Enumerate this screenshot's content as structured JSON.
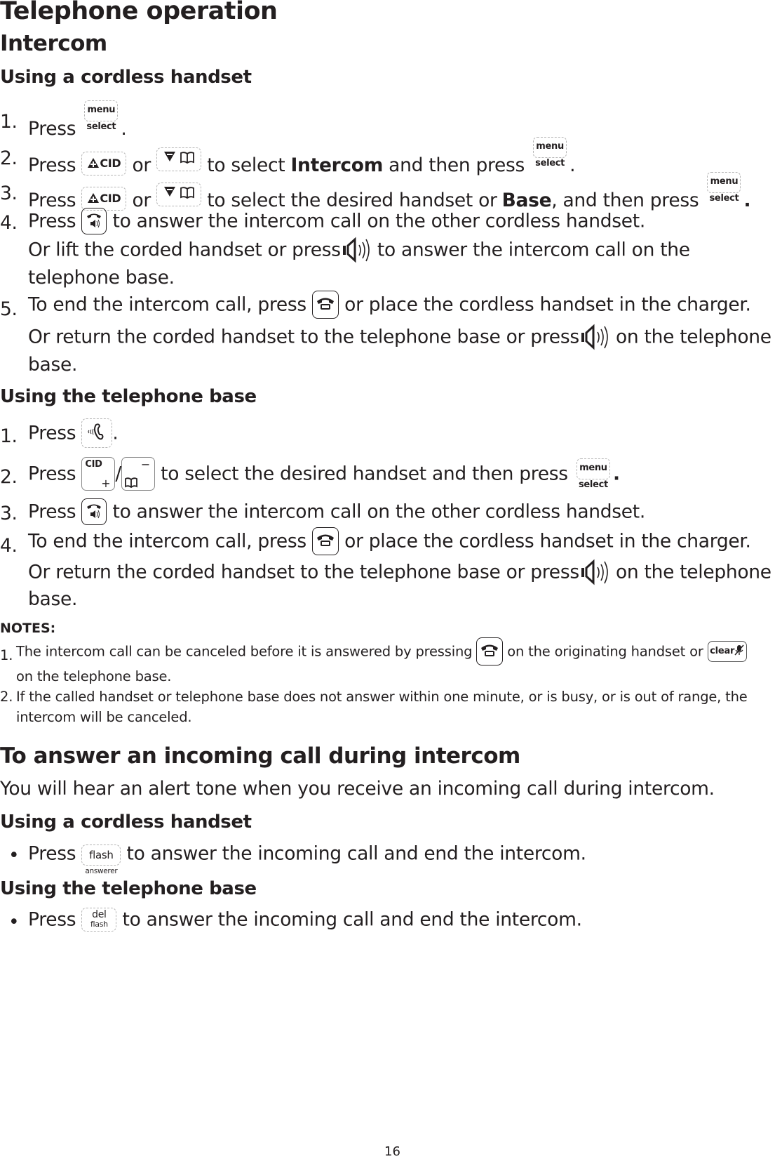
{
  "page": {
    "title": "Telephone operation",
    "section": "Intercom",
    "page_number": "16"
  },
  "cordless": {
    "heading": "Using a cordless handset",
    "steps": [
      {
        "num": "1.",
        "a": "Press",
        "b": "."
      },
      {
        "num": "2.",
        "a": "Press",
        "or": "or",
        "b": "to select",
        "bold": "Intercom",
        "c": "and then press",
        "d": "."
      },
      {
        "num": "3.",
        "a": "Press",
        "or": "or",
        "b": "to select the desired handset or",
        "bold": "Base",
        "c": ", and then press",
        "d": "."
      },
      {
        "num": "4.",
        "a": "Press",
        "b": "to answer the intercom call on the other cordless handset.",
        "line2a": "Or lift the corded handset or press",
        "line2b": "to answer the intercom call on the",
        "line3": "telephone base."
      },
      {
        "num": "5.",
        "a": "To end the intercom call, press",
        "b": "or place the cordless handset in the charger.",
        "line2a": "Or return the corded handset to the telephone base or press",
        "line2b": "on the telephone",
        "line3": "base."
      }
    ]
  },
  "base": {
    "heading": "Using the telephone base",
    "steps": [
      {
        "num": "1.",
        "a": "Press",
        "b": "."
      },
      {
        "num": "2.",
        "a": "Press",
        "slash": "/",
        "b": "to select the desired handset and then press",
        "c": "."
      },
      {
        "num": "3.",
        "a": "Press",
        "b": "to answer the intercom call on the other cordless handset."
      },
      {
        "num": "4.",
        "a": "To end the intercom call, press",
        "b": "or place the cordless handset in the charger.",
        "line2a": "Or return the corded handset to the telephone base or press",
        "line2b": "on the telephone",
        "line3": "base."
      }
    ]
  },
  "notes": {
    "heading": "NOTES:",
    "items": [
      {
        "num": "1.",
        "a": "The intercom call can be canceled before it is answered by pressing",
        "b": "on the originating handset or",
        "line2": "on the telephone base."
      },
      {
        "num": "2.",
        "a": "If the called handset or telephone base does not answer within one minute, or is busy, or is out of range, the",
        "line2": "intercom will be canceled."
      }
    ]
  },
  "incoming": {
    "heading": "To answer an incoming call during intercom",
    "intro": "You will hear an alert tone when you receive an incoming call during intercom.",
    "cordless_heading": "Using a cordless handset",
    "cordless_bullet": {
      "a": "Press",
      "b": "to answer the incoming call and end the intercom."
    },
    "base_heading": "Using the telephone base",
    "base_bullet": {
      "a": "Press",
      "b": "to answer the incoming call and end the intercom."
    }
  },
  "keys": {
    "menu_top": "menu",
    "menu_bottom": "select",
    "cid": "CID",
    "base_cid": "CID",
    "base_plus": "+",
    "base_minus": "−",
    "flash_top": "flash",
    "flash_bottom": "answerer",
    "del_top": "del",
    "del_bottom": "flash",
    "clear": "clear"
  },
  "icons": {
    "menu_select": "menu-select-key-icon",
    "cid_up": "cid-up-key-icon",
    "dir_down": "directory-down-key-icon",
    "talk_speaker": "talk-speaker-key-icon",
    "speaker": "speaker-icon",
    "end_off": "end-off-key-icon",
    "intercom": "intercom-key-icon",
    "base_cid_plus": "base-cid-plus-key-icon",
    "base_dir_minus": "base-directory-minus-key-icon",
    "flash_answerer": "flash-answerer-key-icon",
    "del_flash": "del-flash-key-icon",
    "clear_mute": "clear-mute-key-icon"
  }
}
